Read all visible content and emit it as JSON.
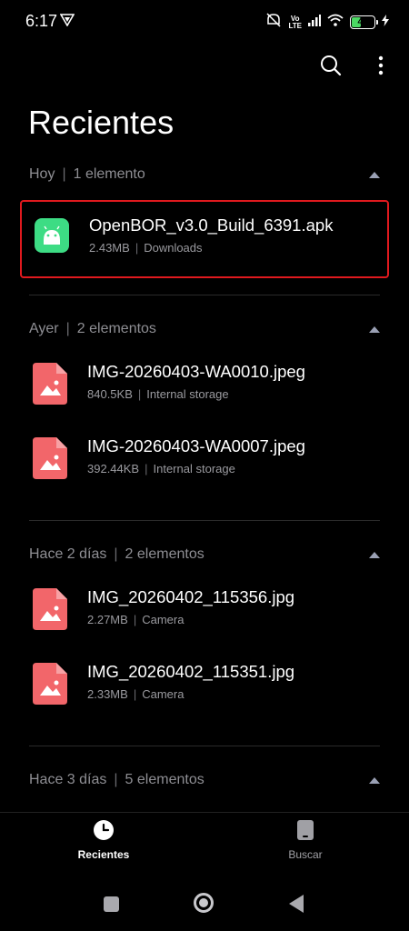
{
  "status_bar": {
    "time": "6:17",
    "network": "Vo LTE",
    "battery": "47",
    "battery_level_percent": 47
  },
  "page": {
    "title": "Recientes"
  },
  "sections": [
    {
      "label": "Hoy",
      "count": "1 elemento",
      "files": [
        {
          "name": "OpenBOR_v3.0_Build_6391.apk",
          "size": "2.43MB",
          "location": "Downloads",
          "icon": "android-apk-icon"
        }
      ]
    },
    {
      "label": "Ayer",
      "count": "2 elementos",
      "files": [
        {
          "name": "IMG-20260403-WA0010.jpeg",
          "size": "840.5KB",
          "location": "Internal storage",
          "icon": "image-file-icon"
        },
        {
          "name": "IMG-20260403-WA0007.jpeg",
          "size": "392.44KB",
          "location": "Internal storage",
          "icon": "image-file-icon"
        }
      ]
    },
    {
      "label": "Hace 2 días",
      "count": "2 elementos",
      "files": [
        {
          "name": "IMG_20260402_115356.jpg",
          "size": "2.27MB",
          "location": "Camera",
          "icon": "image-file-icon"
        },
        {
          "name": "IMG_20260402_115351.jpg",
          "size": "2.33MB",
          "location": "Camera",
          "icon": "image-file-icon"
        }
      ]
    },
    {
      "label": "Hace 3 días",
      "count": "5 elementos",
      "files": []
    }
  ],
  "bottom_nav": {
    "recientes": "Recientes",
    "buscar": "Buscar"
  },
  "colors": {
    "background": "#000000",
    "highlight_border": "#e0191e",
    "apk_icon_green": "#3ddc84",
    "image_icon_red": "#f2666a",
    "secondary_text": "#8e8e93"
  },
  "icons": {
    "search": "search-icon",
    "more": "more-vertical-icon",
    "recent": "clock-icon",
    "browse": "phone-icon"
  }
}
